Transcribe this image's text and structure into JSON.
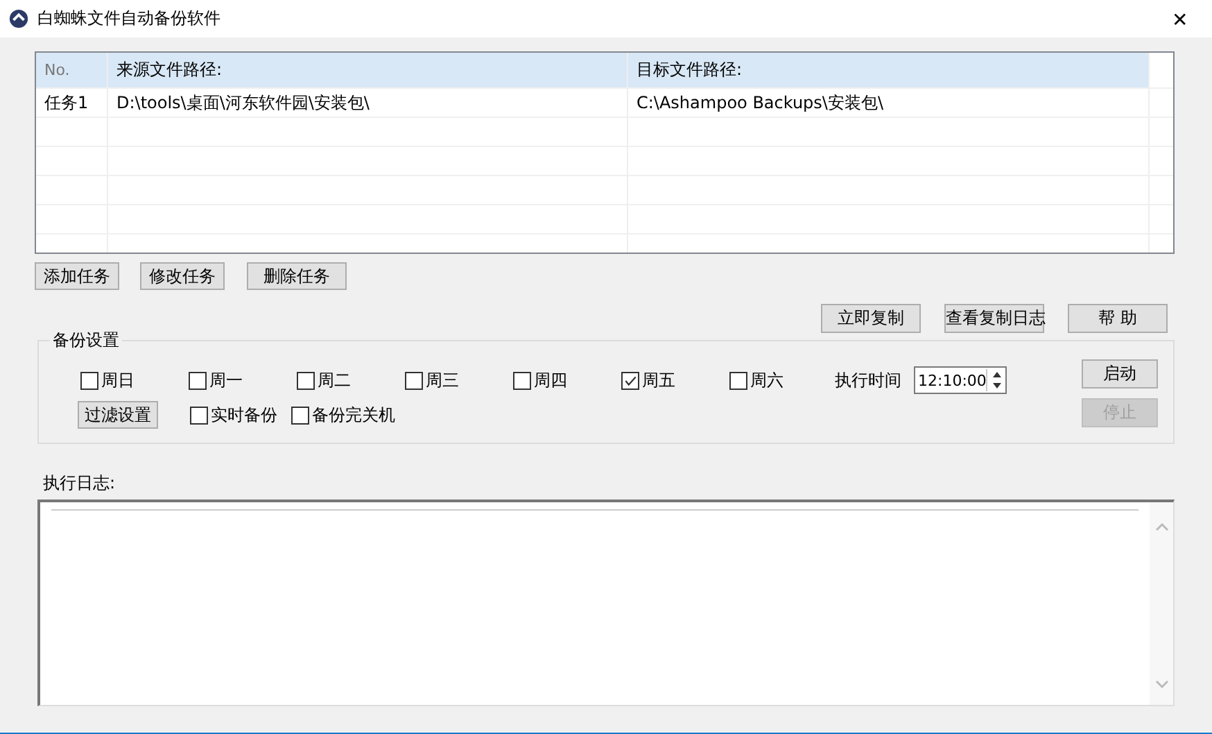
{
  "window": {
    "title": "白蜘蛛文件自动备份软件",
    "close": "✕"
  },
  "table": {
    "columns": [
      "No.",
      "来源文件路径:",
      "目标文件路径:"
    ],
    "rows": [
      {
        "cells": [
          "任务1",
          "D:\\tools\\桌面\\河东软件园\\安装包\\",
          "C:\\Ashampoo Backups\\安装包\\"
        ],
        "selected": false
      }
    ]
  },
  "task_buttons": [
    "添加任务",
    "修改任务",
    "删除任务"
  ],
  "action_buttons": [
    "立即复制",
    "查看复制日志",
    "帮 助"
  ],
  "backup_settings": {
    "legend": "备份设置",
    "days": [
      {
        "label": "周日",
        "checked": false
      },
      {
        "label": "周一",
        "checked": false
      },
      {
        "label": "周二",
        "checked": false
      },
      {
        "label": "周三",
        "checked": false
      },
      {
        "label": "周四",
        "checked": false
      },
      {
        "label": "周五",
        "checked": true
      },
      {
        "label": "周六",
        "checked": false
      }
    ],
    "time_label": "执行时间",
    "time_value": "12:10:00",
    "filter_button": "过滤设置",
    "options": [
      {
        "label": "实时备份",
        "checked": false
      },
      {
        "label": "备份完关机",
        "checked": false
      }
    ],
    "start_button": {
      "label": "启动",
      "disabled": false
    },
    "stop_button": {
      "label": "停止",
      "disabled": true
    }
  },
  "log": {
    "label": "执行日志:"
  }
}
